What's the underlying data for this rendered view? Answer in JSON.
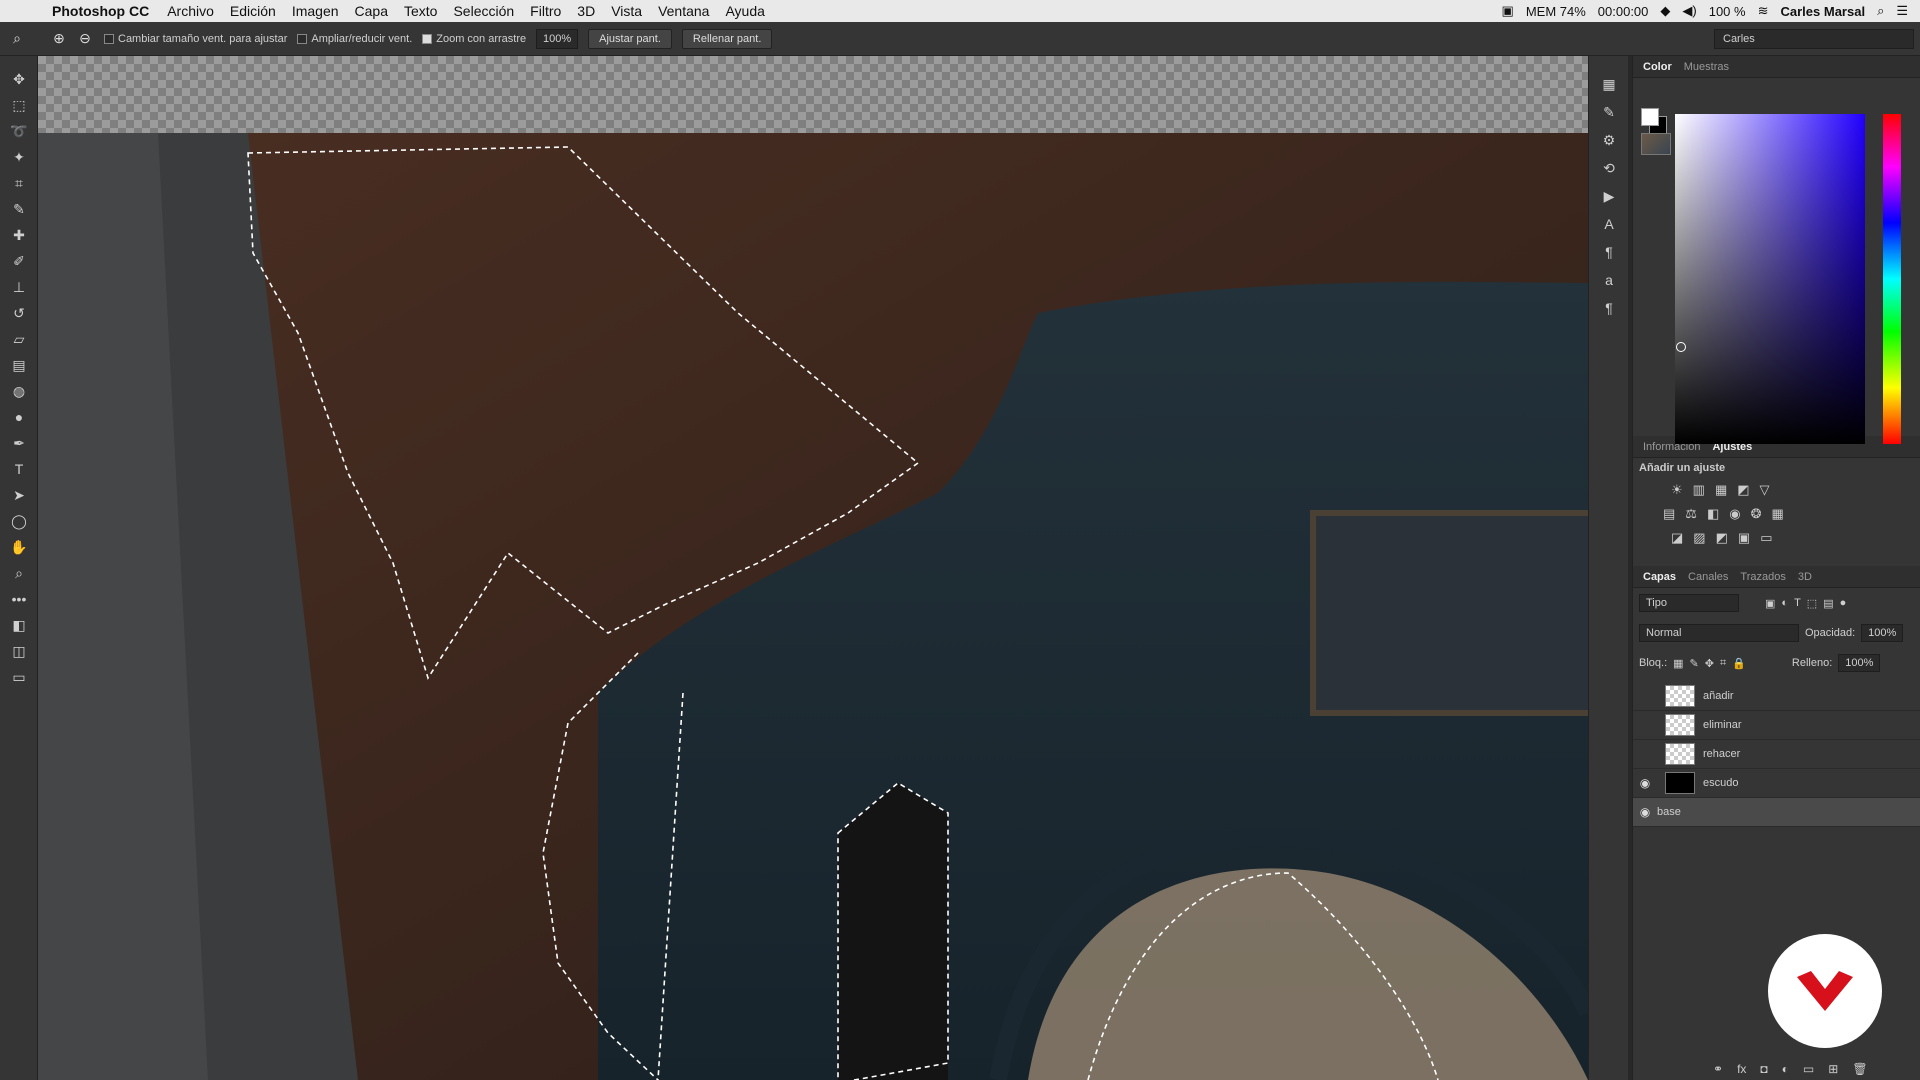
{
  "menubar": {
    "app_name": "Photoshop CC",
    "items": [
      "Archivo",
      "Edición",
      "Imagen",
      "Capa",
      "Texto",
      "Selección",
      "Filtro",
      "3D",
      "Vista",
      "Ventana",
      "Ayuda"
    ],
    "mem": "MEM 74%",
    "timer": "00:00:00",
    "battery": "100 %",
    "user": "Carles Marsal"
  },
  "options": {
    "resize_windows": "Cambiar tamaño vent. para ajustar",
    "zoom_all": "Ampliar/reducir vent.",
    "scrubby_zoom": "Zoom con arrastre",
    "zoom_value": "100%",
    "fit_screen": "Ajustar pant.",
    "fill_screen": "Rellenar pant.",
    "workspace": "Carles"
  },
  "color_panel": {
    "tabs": [
      "Color",
      "Muestras"
    ]
  },
  "adjustments_panel": {
    "tabs": [
      "Información",
      "Ajustes"
    ],
    "heading": "Añadir un ajuste"
  },
  "layers_panel": {
    "tabs": [
      "Capas",
      "Canales",
      "Trazados",
      "3D"
    ],
    "filter": "Tipo",
    "blend_mode": "Normal",
    "opacity_label": "Opacidad:",
    "opacity_value": "100%",
    "lock_label": "Bloq.:",
    "fill_label": "Relleno:",
    "fill_value": "100%",
    "layers": [
      {
        "name": "añadir",
        "visible": false
      },
      {
        "name": "eliminar",
        "visible": false
      },
      {
        "name": "rehacer",
        "visible": false
      },
      {
        "name": "escudo",
        "visible": true
      },
      {
        "name": "base",
        "visible": true,
        "selected": true
      }
    ]
  },
  "colors": {
    "ui_bg": "#353535",
    "canvas_dark": "#1e1b18",
    "brand_red": "#d6111b"
  }
}
